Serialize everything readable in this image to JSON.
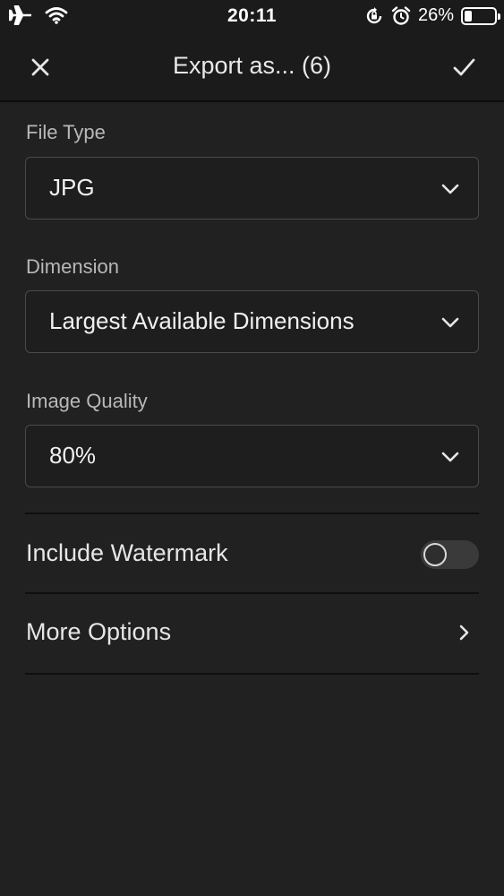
{
  "status_bar": {
    "time": "20:11",
    "battery_percent": "26%",
    "battery_level": 0.26,
    "icons": [
      "airplane-icon",
      "wifi-icon",
      "orientation-lock-icon",
      "alarm-icon",
      "battery-icon"
    ]
  },
  "nav": {
    "title": "Export as... (6)",
    "close_icon": "close-icon",
    "confirm_icon": "checkmark-icon"
  },
  "form": {
    "file_type": {
      "label": "File Type",
      "value": "JPG"
    },
    "dimension": {
      "label": "Dimension",
      "value": "Largest Available Dimensions"
    },
    "image_quality": {
      "label": "Image Quality",
      "value": "80%"
    }
  },
  "watermark": {
    "label": "Include Watermark",
    "enabled": false
  },
  "more_options": {
    "label": "More Options"
  },
  "colors": {
    "background": "#212121",
    "bar_background": "#1b1b1b",
    "field_border": "#4a4a4a",
    "text_primary": "#e6e6e6",
    "text_secondary": "#b8b8b8"
  }
}
